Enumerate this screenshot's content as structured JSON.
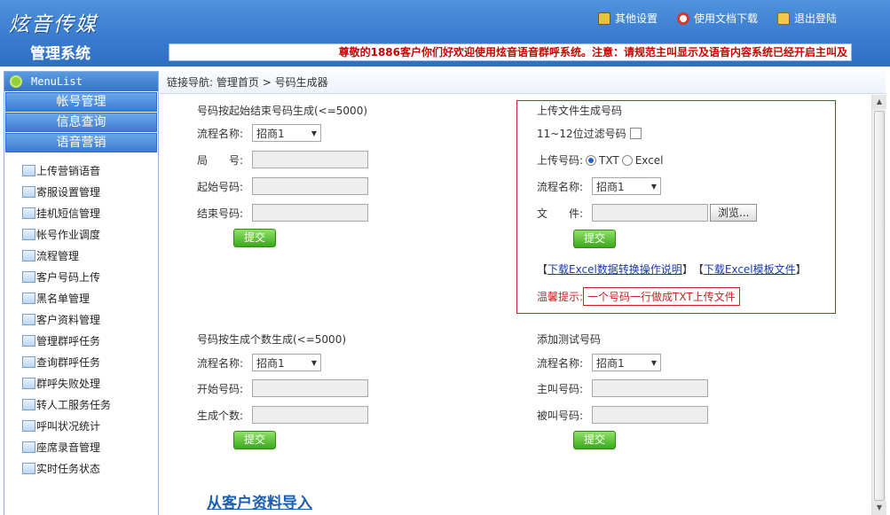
{
  "header": {
    "logo_text": "炫音传媒",
    "system_title": "管理系统",
    "links": [
      {
        "label": "其他设置",
        "icon": "settings-icon"
      },
      {
        "label": "使用文档下载",
        "icon": "help-icon"
      },
      {
        "label": "退出登陆",
        "icon": "lock-icon"
      }
    ],
    "notice": "尊敬的1886客户你们好欢迎使用炫音语音群呼系统。注意：请规范主叫显示及语音内容系统已经开启主叫及"
  },
  "sidebar": {
    "title": "MenuList",
    "groups": [
      "帐号管理",
      "信息查询",
      "语音营销"
    ],
    "items": [
      "上传营销语音",
      "寄服设置管理",
      "挂机短信管理",
      "帐号作业调度",
      "流程管理",
      "客户号码上传",
      "黑名单管理",
      "客户资料管理",
      "管理群呼任务",
      "查询群呼任务",
      "群呼失败处理",
      "转人工服务任务",
      "呼叫状况统计",
      "座席录音管理",
      "实时任务状态"
    ]
  },
  "breadcrumb": {
    "prefix": "链接导航:",
    "home": "管理首页",
    "sep": ">",
    "current": "号码生成器"
  },
  "range_gen": {
    "title": "号码按起始结束号码生成(<=5000)",
    "flow_label": "流程名称:",
    "flow_value": "招商1",
    "bureau_label": "局　　号:",
    "start_label": "起始号码:",
    "end_label": "结束号码:",
    "submit": "提交"
  },
  "upload_gen": {
    "title": "上传文件生成号码",
    "filter_label": "11~12位过滤号码",
    "upload_label": "上传号码:",
    "opt_txt": "TXT",
    "opt_excel": "Excel",
    "flow_label": "流程名称:",
    "flow_value": "招商1",
    "file_label": "文　　件:",
    "browse": "浏览...",
    "submit": "提交",
    "bracket_l": "【",
    "bracket_r": "】",
    "excel_help_link": "下载Excel数据转换操作说明",
    "excel_template_link": "下载Excel模板文件",
    "tip_label": "温馨提示:",
    "tip_text": "一个号码一行做成TXT上传文件"
  },
  "count_gen": {
    "title": "号码按生成个数生成(<=5000)",
    "flow_label": "流程名称:",
    "flow_value": "招商1",
    "start_label": "开始号码:",
    "count_label": "生成个数:",
    "submit": "提交"
  },
  "test_num": {
    "title": "添加测试号码",
    "flow_label": "流程名称:",
    "flow_value": "招商1",
    "caller_label": "主叫号码:",
    "callee_label": "被叫号码:",
    "submit": "提交"
  },
  "import_link": "从客户资料导入"
}
